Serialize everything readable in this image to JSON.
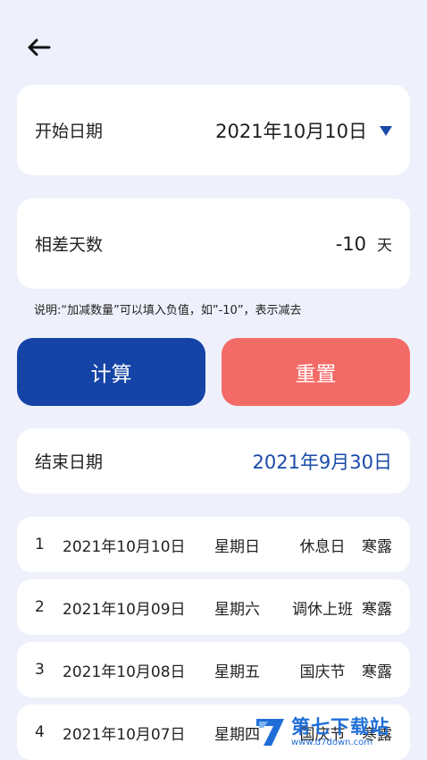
{
  "header": {
    "back_icon": "arrow-left-icon"
  },
  "start_date": {
    "label": "开始日期",
    "value": "2021年10月10日",
    "dropdown_icon": "triangle-down-icon",
    "accent": "#1a4aa8"
  },
  "diff": {
    "label": "相差天数",
    "value": "-10",
    "unit": "天"
  },
  "note": "说明:“加减数量”可以填入负值，如”-10”，表示减去",
  "buttons": {
    "calculate": "计算",
    "reset": "重置",
    "calculate_color": "#1544a6",
    "reset_color": "#f36b66"
  },
  "end_date": {
    "label": "结束日期",
    "value": "2021年9月30日"
  },
  "list": [
    {
      "index": "1",
      "date": "2021年10月10日",
      "weekday": "星期日",
      "type": "休息日",
      "term": "寒露"
    },
    {
      "index": "2",
      "date": "2021年10月09日",
      "weekday": "星期六",
      "type": "调休上班",
      "term": "寒露"
    },
    {
      "index": "3",
      "date": "2021年10月08日",
      "weekday": "星期五",
      "type": "国庆节",
      "term": "寒露"
    },
    {
      "index": "4",
      "date": "2021年10月07日",
      "weekday": "星期四",
      "type": "国庆节",
      "term": "寒露"
    }
  ],
  "watermark": {
    "title": "第七下载站",
    "url": "www.d7down.com"
  }
}
